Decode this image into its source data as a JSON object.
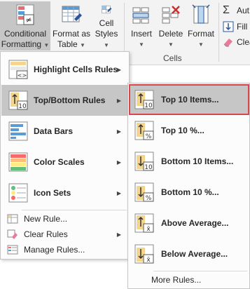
{
  "ribbon": {
    "conditional_formatting": {
      "line1": "Conditional",
      "line2": "Formatting",
      "icon": "conditional-formatting-icon"
    },
    "format_as_table": {
      "line1": "Format as",
      "line2": "Table",
      "icon": "format-as-table-icon"
    },
    "cell_styles": {
      "line1": "Cell",
      "line2": "Styles",
      "icon": "cell-styles-icon"
    },
    "insert": {
      "label": "Insert",
      "icon": "insert-cells-icon"
    },
    "delete": {
      "label": "Delete",
      "icon": "delete-cells-icon"
    },
    "format": {
      "label": "Format",
      "icon": "format-cells-icon"
    },
    "cells_group_label": "Cells",
    "autosum": {
      "label": "Aut",
      "icon": "autosum-icon"
    },
    "fill": {
      "label": "Fill",
      "icon": "fill-icon"
    },
    "clear": {
      "label": "Clea",
      "icon": "clear-icon"
    }
  },
  "menu": {
    "items": [
      {
        "label": "Highlight Cells Rules",
        "icon": "highlight-cells-rules-icon"
      },
      {
        "label": "Top/Bottom Rules",
        "icon": "top-bottom-rules-icon"
      },
      {
        "label": "Data Bars",
        "icon": "data-bars-icon"
      },
      {
        "label": "Color Scales",
        "icon": "color-scales-icon"
      },
      {
        "label": "Icon Sets",
        "icon": "icon-sets-icon"
      }
    ],
    "small_items": [
      {
        "label": "New Rule...",
        "icon": "new-rule-icon"
      },
      {
        "label": "Clear Rules",
        "icon": "clear-rules-icon"
      },
      {
        "label": "Manage Rules...",
        "icon": "manage-rules-icon"
      }
    ]
  },
  "submenu": {
    "items": [
      {
        "label": "Top 10 Items...",
        "icon": "top-10-items-icon"
      },
      {
        "label": "Top 10 %...",
        "icon": "top-10-percent-icon"
      },
      {
        "label": "Bottom 10 Items...",
        "icon": "bottom-10-items-icon"
      },
      {
        "label": "Bottom 10 %...",
        "icon": "bottom-10-percent-icon"
      },
      {
        "label": "Above Average...",
        "icon": "above-average-icon"
      },
      {
        "label": "Below Average...",
        "icon": "below-average-icon"
      }
    ],
    "more_rules": "More Rules..."
  },
  "colors": {
    "selection": "#c6c6c6",
    "highlight_border": "#d9474b",
    "accent_blue": "#2b579a",
    "delete_red": "#c9302c"
  }
}
